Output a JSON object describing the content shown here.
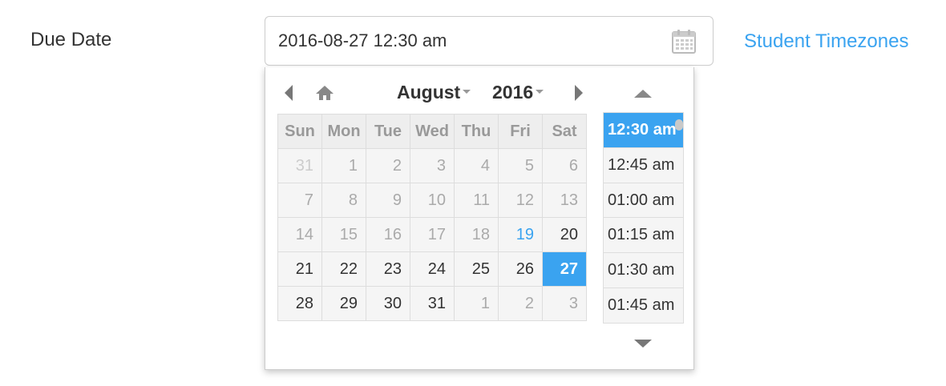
{
  "form": {
    "label": "Due Date",
    "value": "2016-08-27 12:30 am",
    "calendar_icon": "calendar-icon",
    "timezones_link": "Student Timezones",
    "colors": {
      "accent": "#3aa3f0",
      "border": "#cccccc"
    }
  },
  "picker": {
    "nav": {
      "prev_icon": "chevron-left-icon",
      "home_icon": "home-icon",
      "next_icon": "chevron-right-icon",
      "month": "August",
      "year": "2016"
    },
    "weekdays": [
      "Sun",
      "Mon",
      "Tue",
      "Wed",
      "Thu",
      "Fri",
      "Sat"
    ],
    "weeks": [
      [
        "31",
        "1",
        "2",
        "3",
        "4",
        "5",
        "6"
      ],
      [
        "7",
        "8",
        "9",
        "10",
        "11",
        "12",
        "13"
      ],
      [
        "14",
        "15",
        "16",
        "17",
        "18",
        "19",
        "20"
      ],
      [
        "21",
        "22",
        "23",
        "24",
        "25",
        "26",
        "27"
      ],
      [
        "28",
        "29",
        "30",
        "31",
        "1",
        "2",
        "3"
      ]
    ],
    "today": "19",
    "selected_day": "27",
    "times": [
      "12:30 am",
      "12:45 am",
      "01:00 am",
      "01:15 am",
      "01:30 am",
      "01:45 am"
    ],
    "selected_time": "12:30 am",
    "time_up_icon": "triangle-up-icon",
    "time_down_icon": "triangle-down-icon",
    "colors": {
      "selected": "#3aa3f0",
      "cell_bg": "#f5f5f5",
      "header_bg": "#eeeeee"
    }
  }
}
